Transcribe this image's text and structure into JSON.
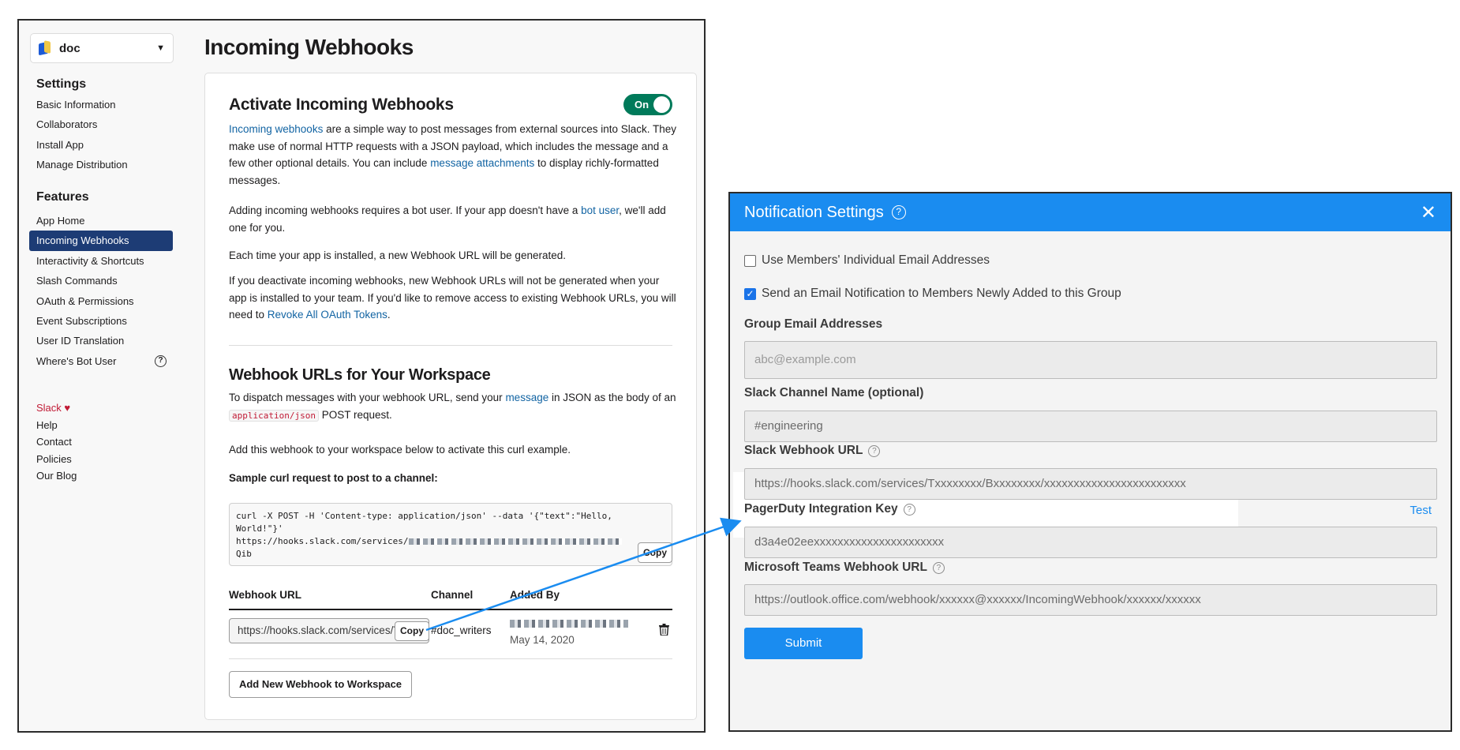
{
  "slack": {
    "workspace": "doc",
    "settings_heading": "Settings",
    "settings_items": [
      "Basic Information",
      "Collaborators",
      "Install App",
      "Manage Distribution"
    ],
    "features_heading": "Features",
    "features_items": [
      "App Home",
      "Incoming Webhooks",
      "Interactivity & Shortcuts",
      "Slash Commands",
      "OAuth & Permissions",
      "Event Subscriptions",
      "User ID Translation",
      "Where's Bot User"
    ],
    "footer_links": [
      "Slack ♥",
      "Help",
      "Contact",
      "Policies",
      "Our Blog"
    ],
    "page_title": "Incoming Webhooks",
    "activate": {
      "title": "Activate Incoming Webhooks",
      "toggle_label": "On",
      "p1_link": "Incoming webhooks",
      "p1_a": " are a simple way to post messages from external sources into Slack. They make use of normal HTTP requests with a JSON payload, which includes the message and a few other optional details. You can include ",
      "p1_link2": "message attachments",
      "p1_b": " to display richly-formatted messages.",
      "p2_a": "Adding incoming webhooks requires a bot user. If your app doesn't have a ",
      "p2_link": "bot user",
      "p2_b": ", we'll add one for you.",
      "p3": "Each time your app is installed, a new Webhook URL will be generated.",
      "p4_a": "If you deactivate incoming webhooks, new Webhook URLs will not be generated when your app is installed to your team. If you'd like to remove access to existing Webhook URLs, you will need to ",
      "p4_link": "Revoke All OAuth Tokens",
      "p4_b": "."
    },
    "workspace_urls": {
      "title": "Webhook URLs for Your Workspace",
      "p1_a": "To dispatch messages with your webhook URL, send your ",
      "p1_link": "message",
      "p1_b": " in JSON as the body of an ",
      "p1_code": "application/json",
      "p1_c": " POST request.",
      "p2": "Add this webhook to your workspace below to activate this curl example.",
      "sample_label": "Sample curl request to post to a channel:",
      "curl_line1": "curl -X POST -H 'Content-type: application/json' --data '{\"text\":\"Hello,",
      "curl_line2": "World!\"}'",
      "curl_line3": "https://hooks.slack.com/services/",
      "curl_line4": "Qib",
      "copy_label": "Copy",
      "col_url": "Webhook URL",
      "col_channel": "Channel",
      "col_added": "Added By",
      "row_url": "https://hooks.slack.com/services/T0000",
      "row_copy": "Copy",
      "row_channel": "#doc_writers",
      "row_date": "May 14, 2020",
      "add_button": "Add New Webhook to Workspace"
    }
  },
  "notification": {
    "title": "Notification Settings",
    "check1": "Use Members' Individual Email Addresses",
    "check1_checked": false,
    "check2": "Send an Email Notification to Members Newly Added to this Group",
    "check2_checked": true,
    "group_email_label": "Group Email Addresses",
    "group_email_placeholder": "abc@example.com",
    "slack_channel_label": "Slack Channel Name (optional)",
    "slack_channel_placeholder": "#engineering",
    "webhook_label": "Slack Webhook URL",
    "webhook_placeholder": "https://hooks.slack.com/services/Txxxxxxxx/Bxxxxxxxx/xxxxxxxxxxxxxxxxxxxxxxxx",
    "pagerduty_label": "PagerDuty Integration Key",
    "pagerduty_test": "Test",
    "pagerduty_placeholder": "d3a4e02eexxxxxxxxxxxxxxxxxxxxxx",
    "teams_label": "Microsoft Teams Webhook URL",
    "teams_placeholder": "https://outlook.office.com/webhook/xxxxxx@xxxxxx/IncomingWebhook/xxxxxx/xxxxxx",
    "submit": "Submit"
  },
  "colors": {
    "slack_green": "#007a5a",
    "slack_nav_active": "#1d3c75",
    "link": "#1264a3",
    "notif_blue": "#1a8cf0",
    "arrow": "#1a8cf0"
  }
}
